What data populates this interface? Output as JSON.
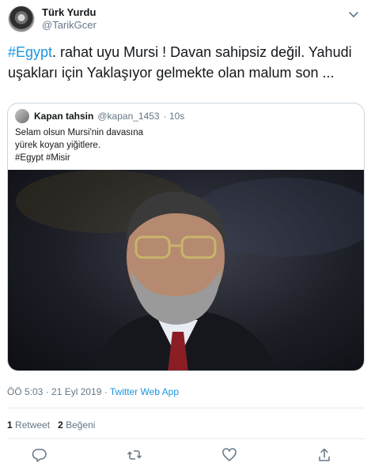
{
  "account": {
    "display_name": "Türk Yurdu",
    "handle": "@TarikGcer"
  },
  "tweet": {
    "hashtag": "#Egypt",
    "line1_rest": ". rahat uyu Mursi ! Davan  sahipsiz değil. Yahudi",
    "line2": "uşakları için Yaklaşıyor gelmekte olan malum son ..."
  },
  "quote": {
    "display_name": "Kapan tahsin",
    "handle": "@kapan_1453",
    "time": "· 10s",
    "lines": [
      "Selam olsun Mursi'nin davasına",
      "yürek koyan yiğitlere.",
      "#Egypt #Misir"
    ]
  },
  "meta": {
    "timestamp": "ÖÖ 5:03 · 21 Eyl 2019 · ",
    "app": "Twitter Web App"
  },
  "stats": {
    "retweet_count": "1",
    "retweet_label": "Retweet",
    "like_count": "2",
    "like_label": "Beğeni"
  },
  "icons": {
    "menu": "chevron-down-icon",
    "reply": "reply-icon",
    "retweet": "retweet-icon",
    "like": "heart-icon",
    "share": "share-icon"
  },
  "colors": {
    "accent": "#1b95e0",
    "muted": "#657786",
    "border": "#ccd6dd"
  }
}
